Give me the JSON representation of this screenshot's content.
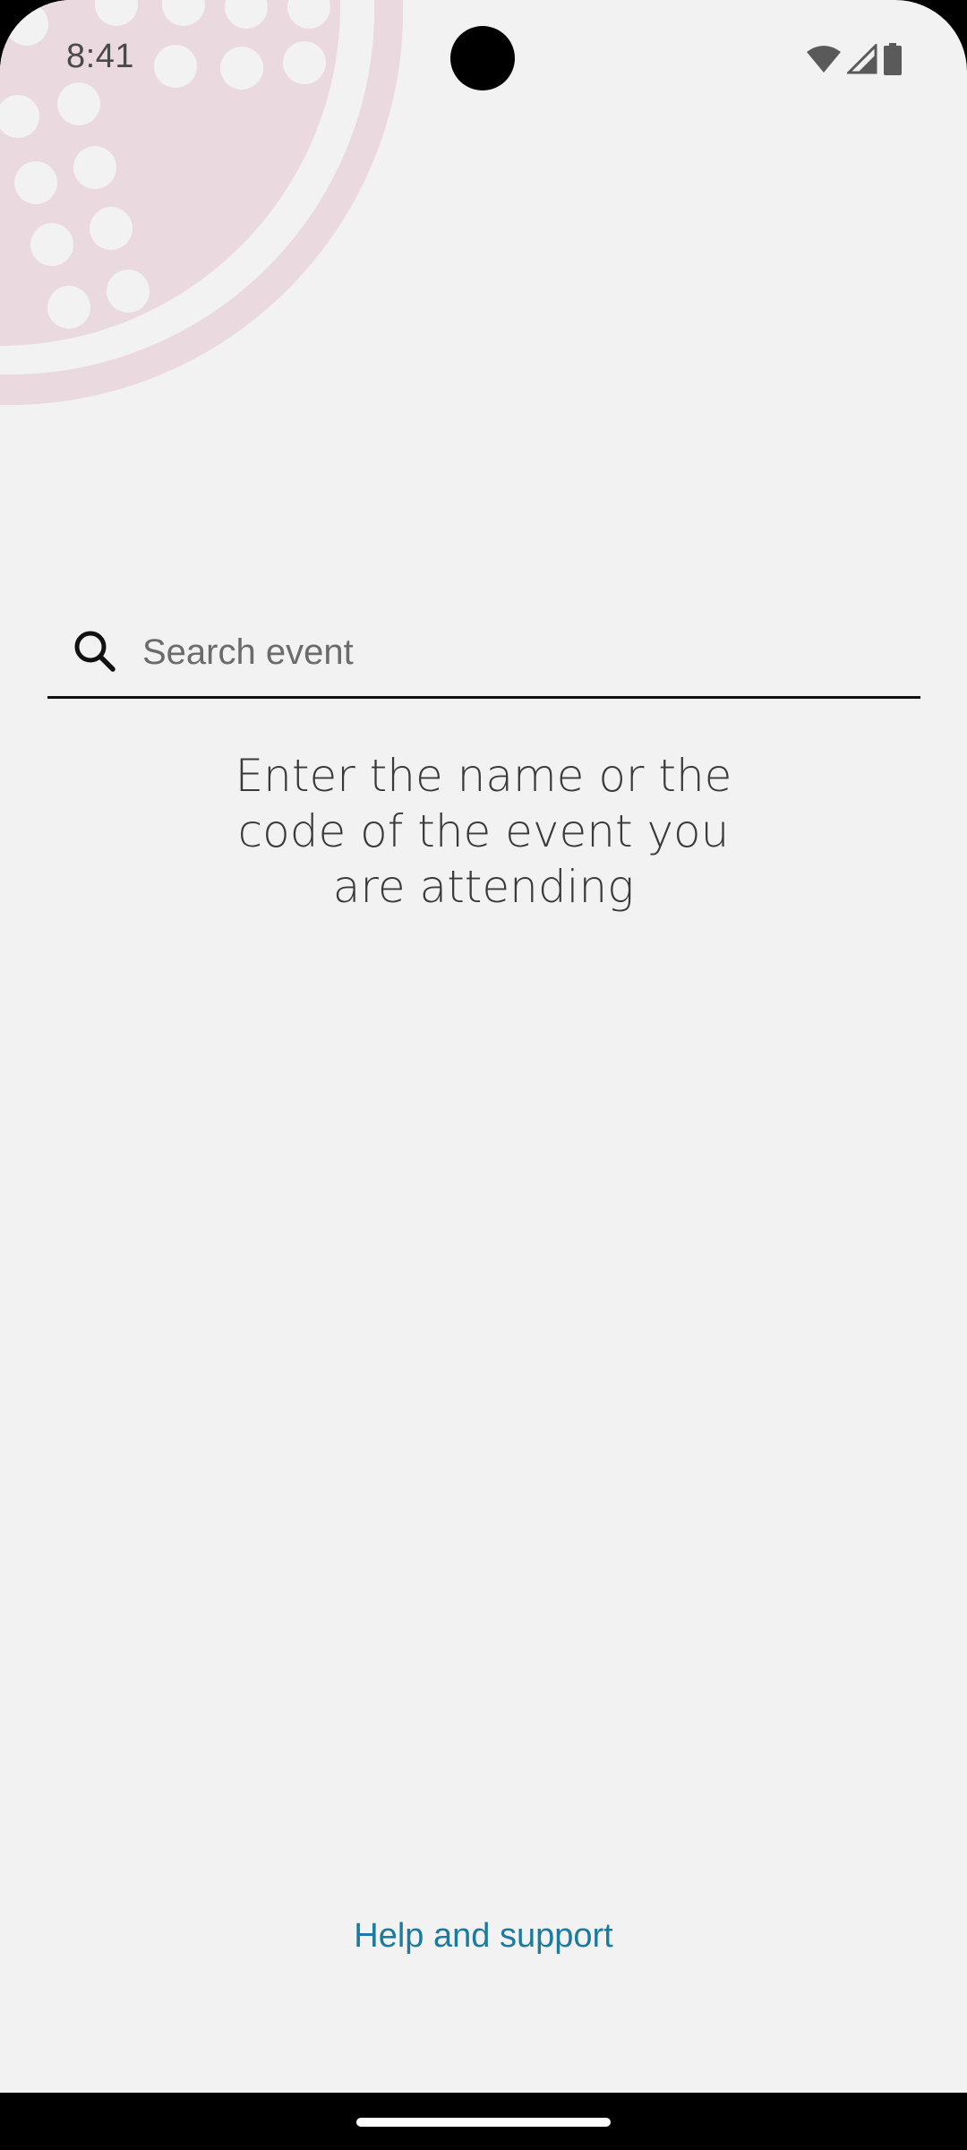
{
  "status_bar": {
    "time": "8:41",
    "icons": [
      "wifi-icon",
      "cellular-signal-icon",
      "battery-icon"
    ]
  },
  "search": {
    "placeholder": "Search event",
    "value": "",
    "icon": "search-icon"
  },
  "hint": {
    "text": "Enter the name or the code of the event you are attending"
  },
  "footer": {
    "help_label": "Help and support"
  },
  "colors": {
    "background": "#f2f2f2",
    "decor_pink": "#ead9df",
    "link": "#1b7a9e",
    "underline": "#111111"
  }
}
